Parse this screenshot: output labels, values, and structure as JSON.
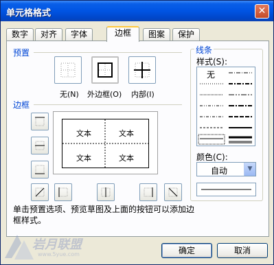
{
  "window": {
    "title": "单元格格式",
    "close_glyph": "✕"
  },
  "tabs": [
    {
      "label": "数字"
    },
    {
      "label": "对齐"
    },
    {
      "label": "字体"
    },
    {
      "label": "边框"
    },
    {
      "label": "图案"
    },
    {
      "label": "保护"
    }
  ],
  "preset": {
    "group_label": "预置",
    "none_label": "无(N)",
    "outline_label": "外边框(O)",
    "inside_label": "内部(I)"
  },
  "border": {
    "group_label": "边框",
    "preview_cells": [
      "文本",
      "文本",
      "文本",
      "文本"
    ]
  },
  "line": {
    "group_label": "线条",
    "style_label": "样式(S):",
    "none_style": "无",
    "color_label": "颜色(C):",
    "color_value": "自动"
  },
  "hint": "单击预置选项、预览草图及上面的按钮可以添加边框样式。",
  "buttons": {
    "ok": "确定",
    "cancel": "取消"
  },
  "watermark": {
    "text": "岩月联盟",
    "url": "www.5yue.com"
  },
  "colors": {
    "accent": "#0046d5",
    "title_bar": "#0054e3"
  }
}
